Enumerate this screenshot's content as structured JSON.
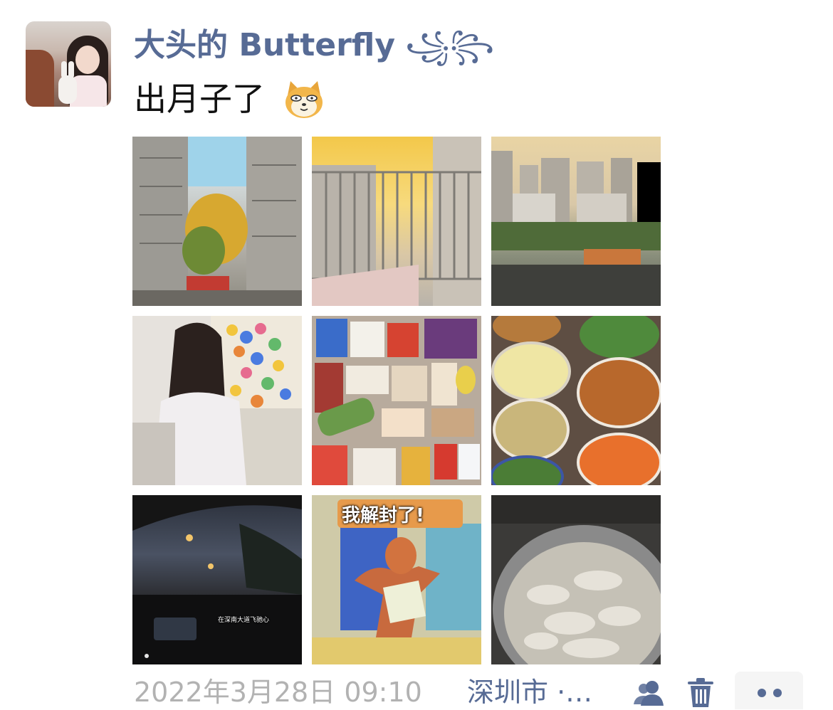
{
  "post": {
    "username": "大头的 Butterfly",
    "username_decoration": "꧁꧂",
    "text": "出月子了",
    "emoji": "dog-emoji-icon",
    "photos": [
      {
        "caption": ""
      },
      {
        "caption": ""
      },
      {
        "caption": ""
      },
      {
        "caption": ""
      },
      {
        "caption": ""
      },
      {
        "caption": ""
      },
      {
        "caption": "在深南大道飞驰心"
      },
      {
        "caption": "我解封了!"
      },
      {
        "caption": ""
      }
    ],
    "timestamp": "2022年3月28日 09:10",
    "location": "深圳市 ·…"
  },
  "icons": {
    "visibility": "friends-visibility-icon",
    "delete": "trash-icon",
    "more": "more-dots-icon"
  },
  "colors": {
    "link_blue": "#576b95",
    "timestamp_gray": "#b2b2b2",
    "text": "#111111"
  }
}
